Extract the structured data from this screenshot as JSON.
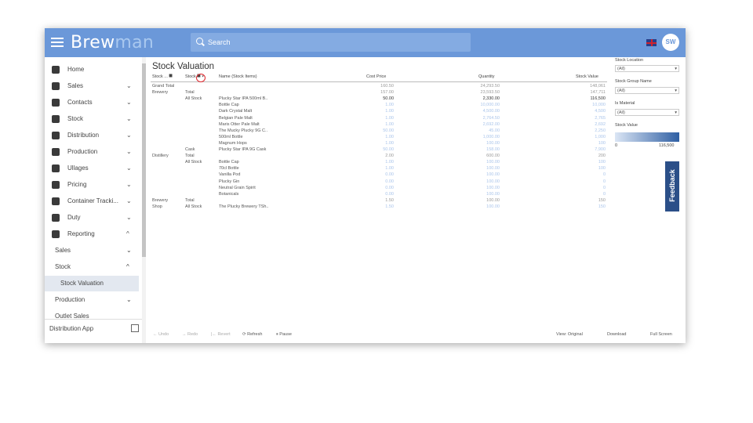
{
  "header": {
    "logo_a": "Brew",
    "logo_b": "man",
    "search_placeholder": "Search",
    "avatar": "SW"
  },
  "sidebar": {
    "items": [
      {
        "label": "Home",
        "icon": "home-icon"
      },
      {
        "label": "Sales",
        "icon": "cart-icon",
        "chevron": "⌄"
      },
      {
        "label": "Contacts",
        "icon": "contacts-icon",
        "chevron": "⌄"
      },
      {
        "label": "Stock",
        "icon": "funnel-icon",
        "chevron": "⌄"
      },
      {
        "label": "Distribution",
        "icon": "truck-icon",
        "chevron": "⌄"
      },
      {
        "label": "Production",
        "icon": "production-icon",
        "chevron": "⌄"
      },
      {
        "label": "Ullages",
        "icon": "bin-icon",
        "chevron": "⌄"
      },
      {
        "label": "Pricing",
        "icon": "dollar-icon",
        "chevron": "⌄"
      },
      {
        "label": "Container Tracki...",
        "icon": "target-icon",
        "chevron": "⌄"
      },
      {
        "label": "Duty",
        "icon": "duty-icon",
        "chevron": "⌄"
      },
      {
        "label": "Reporting",
        "icon": "report-icon",
        "chevron": "^"
      }
    ],
    "sub": [
      {
        "label": "Sales",
        "chevron": "⌄"
      },
      {
        "label": "Stock",
        "chevron": "^"
      },
      {
        "label": "Stock Valuation",
        "chevron": ""
      },
      {
        "label": "Production",
        "chevron": "⌄"
      },
      {
        "label": "Outlet Sales",
        "chevron": ""
      }
    ],
    "footer": "Distribution App"
  },
  "report": {
    "title": "Stock Valuation",
    "columns": {
      "c1": "Stock ... ⯀",
      "c2": "Stock ⯀ ▾",
      "c3": "Name (Stock Items)",
      "c4": "Cost Price",
      "c5": "Quantity",
      "c6": "Stock Value"
    },
    "rows": [
      {
        "a": "Grand Total",
        "b": "",
        "c": "",
        "cost": "160.50",
        "qty": "24,293.50",
        "val": "148,061",
        "st": "muted"
      },
      {
        "a": "Brewery",
        "b": "Total",
        "c": "",
        "cost": "157.00",
        "qty": "23,593.50",
        "val": "147,711",
        "st": "muted"
      },
      {
        "a": "",
        "b": "All Stock",
        "c": "Plucky Star IPA 500ml B..",
        "cost": "50.00",
        "qty": "2,330.00",
        "val": "116,500",
        "st": "dark"
      },
      {
        "a": "",
        "b": "",
        "c": "Bottle Cap",
        "cost": "1.00",
        "qty": "10,000.00",
        "val": "10,000",
        "st": "faint"
      },
      {
        "a": "",
        "b": "",
        "c": "Dark Crystal Malt",
        "cost": "1.00",
        "qty": "4,500.00",
        "val": "4,500",
        "st": "faint"
      },
      {
        "a": "",
        "b": "",
        "c": "Belgian Pale Malt",
        "cost": "1.00",
        "qty": "2,764.50",
        "val": "2,765",
        "st": "faint"
      },
      {
        "a": "",
        "b": "",
        "c": "Maris Otter Pale Malt",
        "cost": "1.00",
        "qty": "2,692.00",
        "val": "2,692",
        "st": "faint"
      },
      {
        "a": "",
        "b": "",
        "c": "The Mucky Plucky 9G C..",
        "cost": "50.00",
        "qty": "45.00",
        "val": "2,250",
        "st": "faint"
      },
      {
        "a": "",
        "b": "",
        "c": "500ml Bottle",
        "cost": "1.00",
        "qty": "1,000.00",
        "val": "1,000",
        "st": "faint"
      },
      {
        "a": "",
        "b": "",
        "c": "Magnum Hops",
        "cost": "1.00",
        "qty": "100.00",
        "val": "100",
        "st": "faint"
      },
      {
        "a": "",
        "b": "Cask",
        "c": "Plucky Star IPA 9G Cask",
        "cost": "50.00",
        "qty": "158.00",
        "val": "7,900",
        "st": "faint"
      },
      {
        "a": "Distillery",
        "b": "Total",
        "c": "",
        "cost": "2.00",
        "qty": "600.00",
        "val": "200",
        "st": "muted"
      },
      {
        "a": "",
        "b": "All Stock",
        "c": "Bottle Cap",
        "cost": "1.00",
        "qty": "100.00",
        "val": "100",
        "st": "faint"
      },
      {
        "a": "",
        "b": "",
        "c": "70cl Bottle",
        "cost": "1.00",
        "qty": "100.00",
        "val": "100",
        "st": "faint"
      },
      {
        "a": "",
        "b": "",
        "c": "Vanilla Pod",
        "cost": "0.00",
        "qty": "100.00",
        "val": "0",
        "st": "faint"
      },
      {
        "a": "",
        "b": "",
        "c": "Plucky Gin",
        "cost": "0.00",
        "qty": "100.00",
        "val": "0",
        "st": "faint"
      },
      {
        "a": "",
        "b": "",
        "c": "Neutral Grain Spirit",
        "cost": "0.00",
        "qty": "100.00",
        "val": "0",
        "st": "faint"
      },
      {
        "a": "",
        "b": "",
        "c": "Botanicals",
        "cost": "0.00",
        "qty": "100.00",
        "val": "0",
        "st": "faint"
      },
      {
        "a": "Brewery",
        "b": "Total",
        "c": "",
        "cost": "1.50",
        "qty": "100.00",
        "val": "150",
        "st": "muted"
      },
      {
        "a": "Shop",
        "b": "All Stock",
        "c": "The Plucky Brewery TSh..",
        "cost": "1.50",
        "qty": "100.00",
        "val": "150",
        "st": "faint"
      }
    ]
  },
  "filters": {
    "stock_location": {
      "label": "Stock Location",
      "value": "(All)"
    },
    "stock_group": {
      "label": "Stock Group Name",
      "value": "(All)"
    },
    "is_material": {
      "label": "Is Material",
      "value": "(All)"
    },
    "stock_value": {
      "label": "Stock Value",
      "min": "0",
      "max": "116,500"
    }
  },
  "toolbar": {
    "undo": "← Undo",
    "redo": "→ Redo",
    "revert": "|← Revert",
    "refresh": "⟳ Refresh",
    "pause": "⏸ Pause",
    "view": "View: Original",
    "download": "Download",
    "fullscreen": "Full Screen"
  },
  "feedback": "Feedback"
}
